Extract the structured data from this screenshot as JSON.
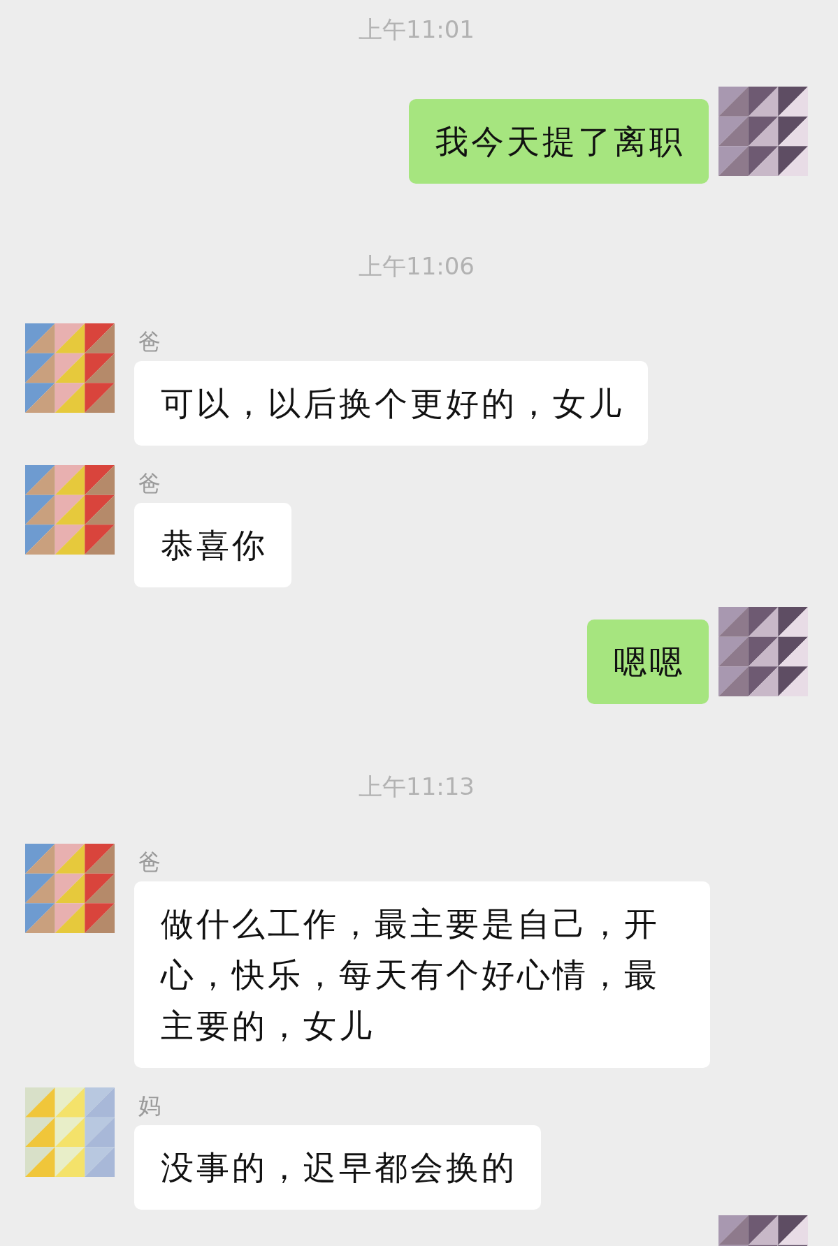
{
  "messages": [
    {
      "kind": "time",
      "text": "上午11:01"
    },
    {
      "kind": "out",
      "text": "我今天提了离职"
    },
    {
      "kind": "time",
      "text": "上午11:06"
    },
    {
      "kind": "in",
      "sender": "爸",
      "text": "可以，以后换个更好的，女儿"
    },
    {
      "kind": "in",
      "sender": "爸",
      "text": "恭喜你"
    },
    {
      "kind": "out",
      "text": "嗯嗯"
    },
    {
      "kind": "time",
      "text": "上午11:13"
    },
    {
      "kind": "in",
      "sender": "爸",
      "text": "做什么工作，最主要是自己，开心，快乐，每天有个好心情，最主要的，女儿"
    },
    {
      "kind": "in",
      "sender": "妈",
      "text": "没事的，迟早都会换的"
    },
    {
      "kind": "avatar_only"
    }
  ]
}
